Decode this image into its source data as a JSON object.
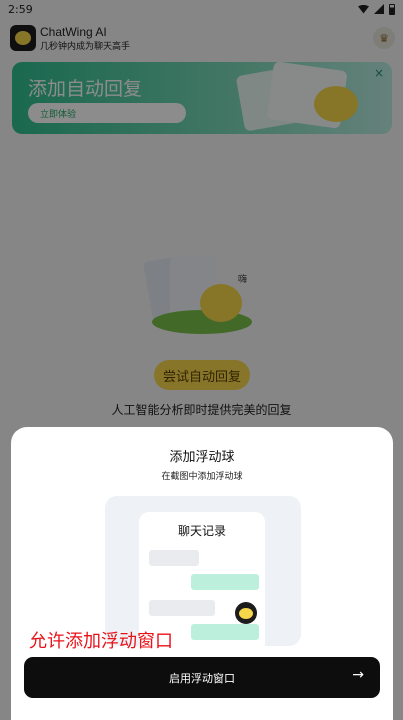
{
  "status_bar": {
    "time": "2:59"
  },
  "app": {
    "name": "ChatWing AI",
    "tagline": "几秒钟内成为聊天高手"
  },
  "banner": {
    "title": "添加自动回复",
    "button": "立即体验",
    "close": "×"
  },
  "hero": {
    "bubble_text": "嗨"
  },
  "main": {
    "try_button": "尝试自动回复",
    "subtitle": "人工智能分析即时提供完美的回复"
  },
  "sheet": {
    "title": "添加浮动球",
    "subtitle": "在截图中添加浮动球",
    "illustration": {
      "phone_title": "聊天记录"
    },
    "annotation": "允许添加浮动窗口",
    "enable_button": "启用浮动窗口",
    "enable_arrow": "→"
  },
  "colors": {
    "accent_green": "#2fbf90",
    "accent_yellow": "#f6d84c",
    "annotation_red": "#e8121a",
    "button_dark": "#0d0d0d"
  },
  "icons": [
    "wifi-icon",
    "signal-icon",
    "battery-icon",
    "crown-icon",
    "close-icon",
    "arrow-right-icon",
    "floating-ball-icon"
  ]
}
